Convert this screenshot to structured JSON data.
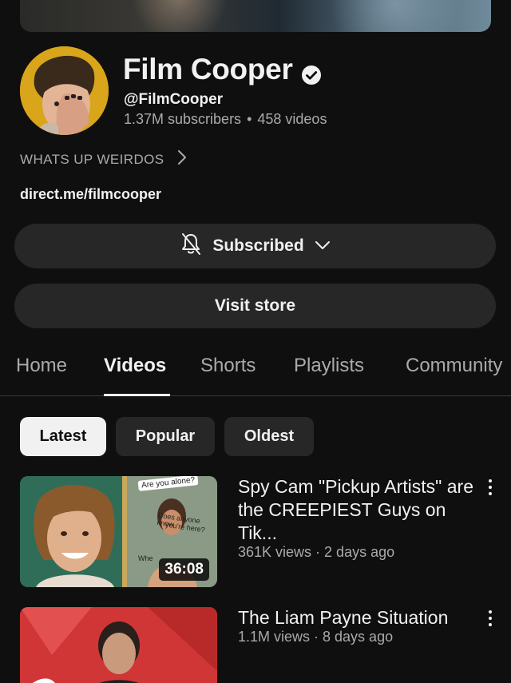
{
  "channel": {
    "name": "Film Cooper",
    "handle": "@FilmCooper",
    "subscribers": "1.37M subscribers",
    "separator": "•",
    "videos_count": "458 videos",
    "about": "WHATS UP WEIRDOS",
    "link": "direct.me/filmcooper"
  },
  "actions": {
    "subscribed_label": "Subscribed",
    "visit_store_label": "Visit store"
  },
  "tabs": [
    {
      "label": "Home",
      "active": false
    },
    {
      "label": "Videos",
      "active": true
    },
    {
      "label": "Shorts",
      "active": false
    },
    {
      "label": "Playlists",
      "active": false
    },
    {
      "label": "Community",
      "active": false
    }
  ],
  "filters": [
    {
      "label": "Latest",
      "active": true
    },
    {
      "label": "Popular",
      "active": false
    },
    {
      "label": "Oldest",
      "active": false
    }
  ],
  "videos": [
    {
      "title": "Spy Cam \"Pickup Artists\" are the CREEPIEST Guys on Tik...",
      "meta": "361K views · 2 days ago",
      "duration": "36:08",
      "thumb_text": {
        "line1": "Are you alone?",
        "line2": "Does anyone know",
        "line3": "you're here?",
        "line4": "Whe"
      }
    },
    {
      "title": "The Liam Payne Situation",
      "meta": "1.1M views · 8 days ago"
    }
  ],
  "icons": {
    "verified": "verified-check-icon",
    "bell_off": "bell-off-icon",
    "chevron_down": "chevron-down-icon",
    "chevron_right": "chevron-right-icon",
    "more": "more-vertical-icon"
  },
  "colors": {
    "background": "#0f0f0f",
    "surface": "#272727",
    "text_primary": "#f1f1f1",
    "text_secondary": "#aaaaaa"
  }
}
